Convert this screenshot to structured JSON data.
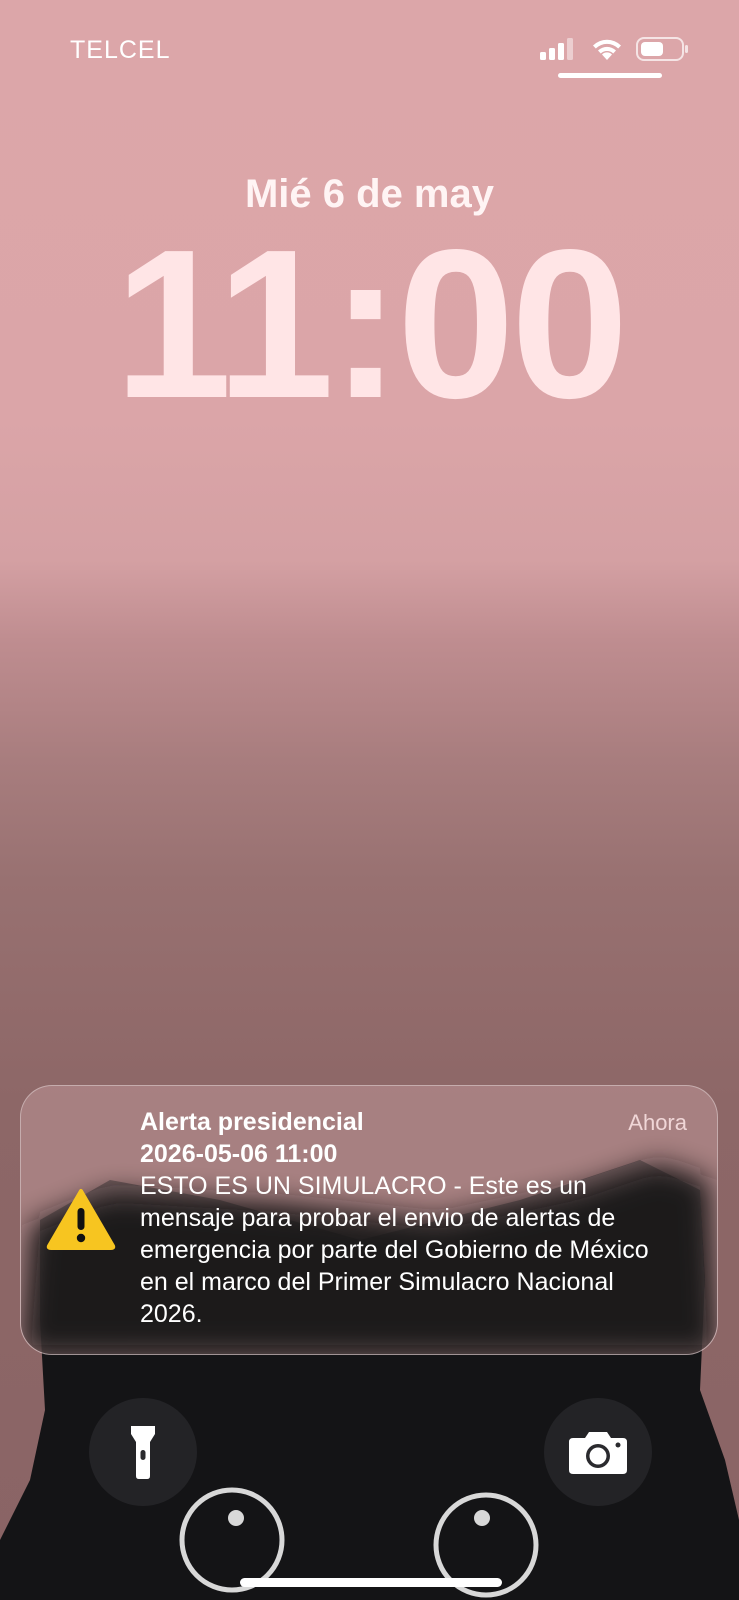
{
  "status_bar": {
    "carrier": "TELCEL",
    "signal_icon": "cellular-signal-icon",
    "wifi_icon": "wifi-icon",
    "battery_icon": "battery-icon"
  },
  "lock_screen": {
    "date": "Mié 6 de may",
    "time": "11:00"
  },
  "notification": {
    "icon": "warning-icon",
    "title": "Alerta presidencial",
    "subtitle": "2026-05-06 11:00",
    "body": "ESTO ES UN SIMULACRO - Este es un mensaje para probar el envio de alertas de emergencia por parte del Gobierno de México en el marco del Primer Simulacro Nacional 2026.",
    "time": "Ahora"
  },
  "quick_actions": {
    "flashlight": "flashlight-icon",
    "camera": "camera-icon"
  },
  "colors": {
    "wallpaper_top": "#dca6a9",
    "wallpaper_bottom": "#8a6465",
    "clock": "#ffe5e6",
    "warning": "#f5c518"
  }
}
